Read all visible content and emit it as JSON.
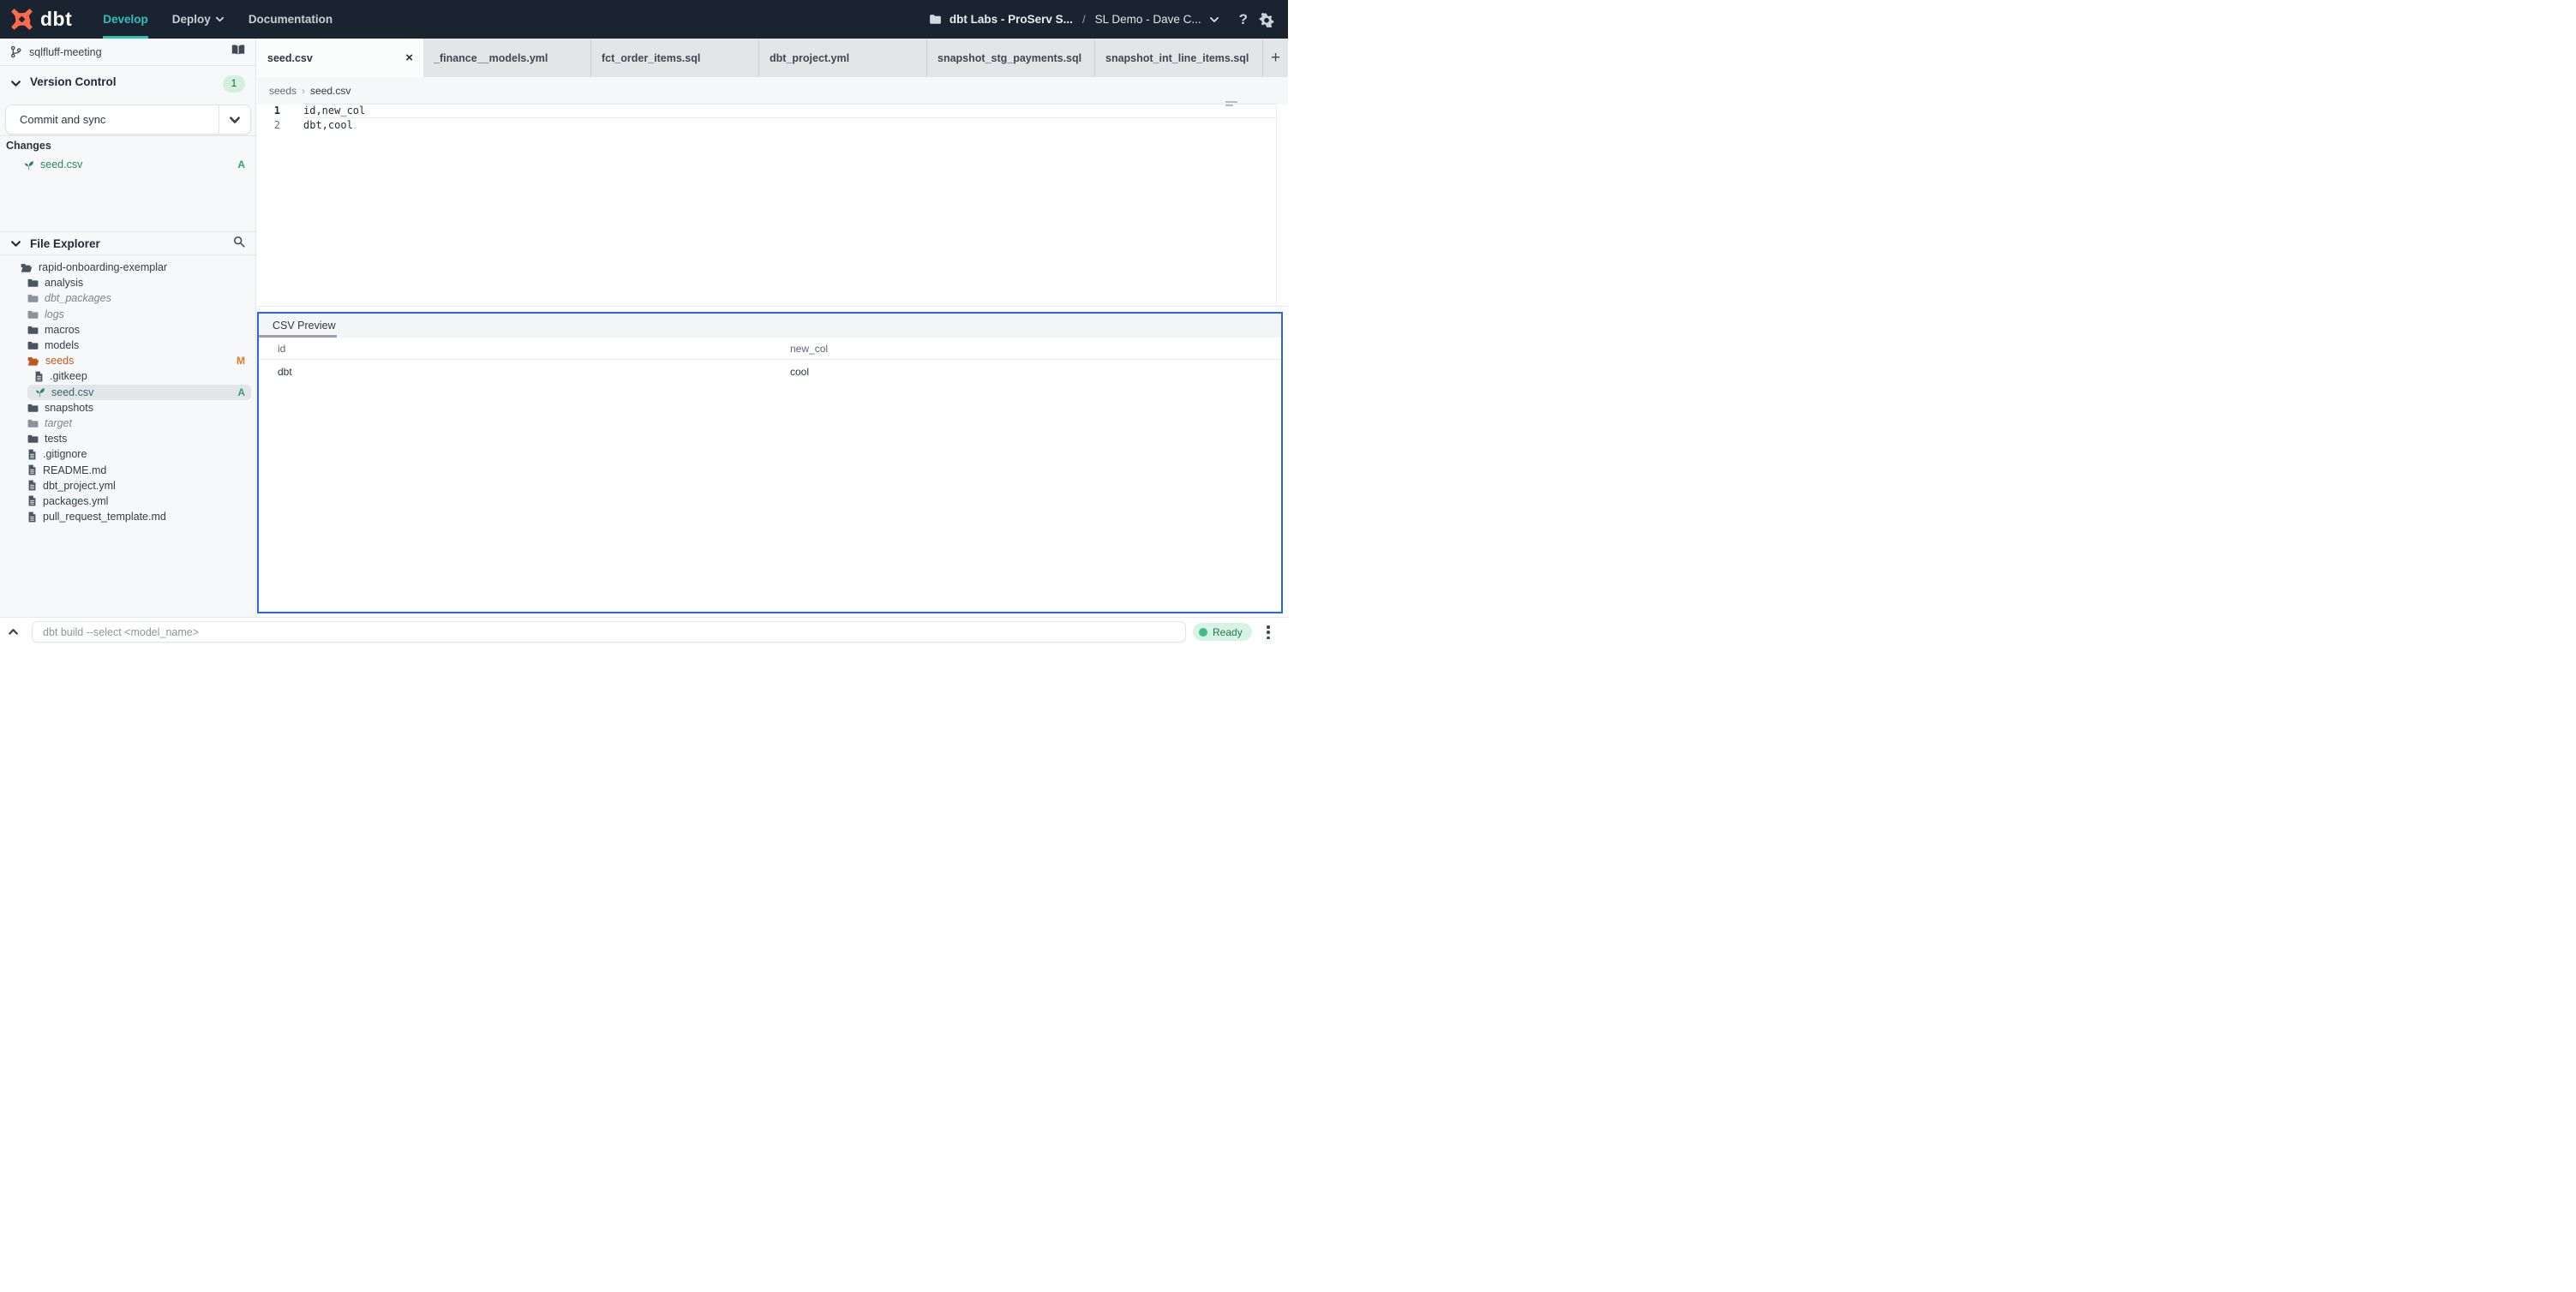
{
  "header": {
    "logo_text": "dbt",
    "nav": [
      {
        "label": "Develop"
      },
      {
        "label": "Deploy"
      },
      {
        "label": "Documentation"
      }
    ],
    "project": "dbt Labs - ProServ S...",
    "separator": "/",
    "environment": "SL Demo - Dave C...",
    "help_glyph": "?"
  },
  "sidebar": {
    "branch": {
      "name": "sqlfluff-meeting"
    },
    "version_control": {
      "title": "Version Control",
      "badge": "1",
      "commit_button": "Commit and sync",
      "changes_label": "Changes",
      "changes": [
        {
          "name": "seed.csv",
          "status": "A"
        }
      ]
    },
    "file_explorer": {
      "title": "File Explorer",
      "items": [
        {
          "name": "rapid-onboarding-exemplar",
          "type": "folder-open",
          "level": 0
        },
        {
          "name": "analysis",
          "type": "folder",
          "level": 1
        },
        {
          "name": "dbt_packages",
          "type": "folder",
          "level": 1,
          "muted": true
        },
        {
          "name": "logs",
          "type": "folder",
          "level": 1,
          "muted": true
        },
        {
          "name": "macros",
          "type": "folder",
          "level": 1
        },
        {
          "name": "models",
          "type": "folder",
          "level": 1
        },
        {
          "name": "seeds",
          "type": "folder-open",
          "level": 1,
          "badge": "M"
        },
        {
          "name": ".gitkeep",
          "type": "file",
          "level": 2
        },
        {
          "name": "seed.csv",
          "type": "seedling",
          "level": 2,
          "badge": "A",
          "selected": true
        },
        {
          "name": "snapshots",
          "type": "folder",
          "level": 1
        },
        {
          "name": "target",
          "type": "folder",
          "level": 1,
          "muted": true
        },
        {
          "name": "tests",
          "type": "folder",
          "level": 1
        },
        {
          "name": ".gitignore",
          "type": "file",
          "level": 1
        },
        {
          "name": "README.md",
          "type": "file",
          "level": 1
        },
        {
          "name": "dbt_project.yml",
          "type": "file",
          "level": 1
        },
        {
          "name": "packages.yml",
          "type": "file",
          "level": 1
        },
        {
          "name": "pull_request_template.md",
          "type": "file",
          "level": 1
        }
      ]
    }
  },
  "tabs": {
    "close_glyph": "×",
    "new_tab_glyph": "+",
    "items": [
      {
        "label": "seed.csv",
        "active": true
      },
      {
        "label": "_finance__models.yml"
      },
      {
        "label": "fct_order_items.sql"
      },
      {
        "label": "dbt_project.yml"
      },
      {
        "label": "snapshot_stg_payments.sql"
      },
      {
        "label": "snapshot_int_line_items.sql"
      }
    ]
  },
  "editor": {
    "breadcrumb": {
      "dir": "seeds",
      "sep": "›",
      "file": "seed.csv"
    },
    "lines": [
      {
        "number": "1",
        "code": "id,new_col"
      },
      {
        "number": "2",
        "code": "dbt,cool"
      }
    ]
  },
  "csv_preview": {
    "title": "CSV Preview",
    "columns": [
      "id",
      "new_col"
    ],
    "rows": [
      [
        "dbt",
        "cool"
      ]
    ]
  },
  "bottom_bar": {
    "placeholder": "dbt build --select <model_name>",
    "status": "Ready"
  },
  "colors": {
    "header_bg": "#1a2430",
    "accent_teal": "#2ec0b7",
    "logo_orange": "#ff6a4c",
    "panel_focus_blue": "#2b66e8",
    "git_added_green": "#35a169",
    "git_modified_orange": "#dd7a1c",
    "ready_green": "#3cbd85"
  }
}
